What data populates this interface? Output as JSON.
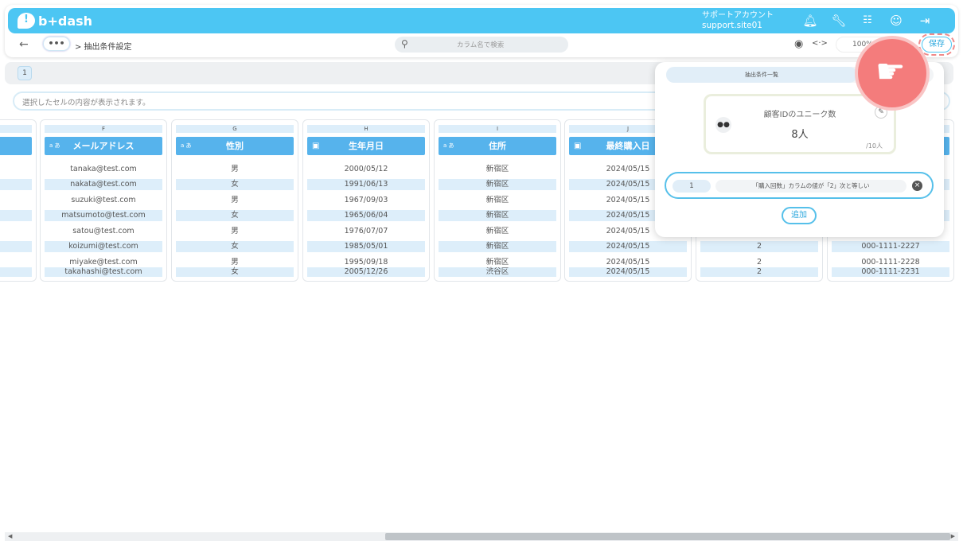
{
  "header": {
    "logo": "b+dash",
    "account_label": "サポートアカウント",
    "account_site": "support.site01"
  },
  "subbar": {
    "back": "←",
    "more": "•••",
    "breadcrumb": "> 抽出条件設定",
    "search_placeholder": "カラム名で検索",
    "zoom": "100%",
    "save_label": "保存"
  },
  "page_number": "1",
  "cell_info_placeholder": "選択したセルの内容が表示されます。",
  "columns": [
    {
      "letter": "F",
      "header": "メールアドレス",
      "type": "a あ",
      "cells": [
        "tanaka@test.com",
        "nakata@test.com",
        "suzuki@test.com",
        "matsumoto@test.com",
        "satou@test.com",
        "koizumi@test.com",
        "miyake@test.com",
        "takahashi@test.com"
      ]
    },
    {
      "letter": "G",
      "header": "性別",
      "type": "a あ",
      "cells": [
        "男",
        "女",
        "男",
        "女",
        "男",
        "女",
        "男",
        "女"
      ]
    },
    {
      "letter": "H",
      "header": "生年月日",
      "type": "date",
      "cells": [
        "2000/05/12",
        "1991/06/13",
        "1967/09/03",
        "1965/06/04",
        "1976/07/07",
        "1985/05/01",
        "1995/09/18",
        "2005/12/26"
      ]
    },
    {
      "letter": "I",
      "header": "住所",
      "type": "a あ",
      "cells": [
        "新宿区",
        "新宿区",
        "新宿区",
        "新宿区",
        "新宿区",
        "新宿区",
        "新宿区",
        "渋谷区"
      ]
    },
    {
      "letter": "J",
      "header": "最終購入日",
      "type": "date",
      "cells": [
        "2024/05/15",
        "2024/05/15",
        "2024/05/15",
        "2024/05/15",
        "2024/05/15",
        "2024/05/15",
        "2024/05/15",
        "2024/05/15"
      ]
    },
    {
      "letter": "",
      "header": "",
      "type": "",
      "cells": [
        "",
        "",
        "",
        "",
        "",
        "2",
        "2",
        "2"
      ]
    },
    {
      "letter": "",
      "header": "",
      "type": "",
      "cells": [
        "",
        "",
        "",
        "",
        "",
        "000-1111-2227",
        "000-1111-2228",
        "000-1111-2231"
      ]
    }
  ],
  "panel": {
    "tab_label": "抽出条件一覧",
    "card_title": "顧客IDのユニーク数",
    "card_value": "8人",
    "card_total": "/10人",
    "condition_number": "1",
    "condition_text": "「購入回数」カラムの値が「2」次と等しい",
    "add_label": "追加"
  }
}
